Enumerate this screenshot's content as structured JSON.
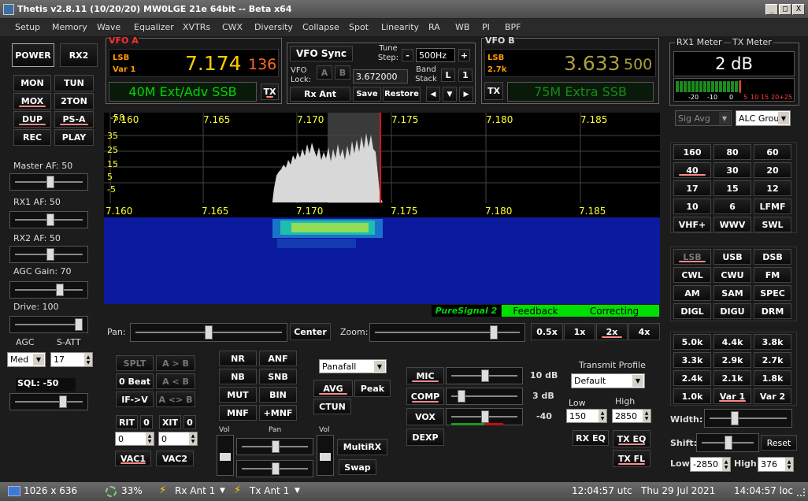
{
  "titlebar": {
    "title": "Thetis v2.8.11 (10/20/20) MW0LGE 21e 64bit -- Beta x64",
    "minimize": "_",
    "maximize": "□",
    "close": "X"
  },
  "menu": [
    "Setup",
    "Memory",
    "Wave",
    "Equalizer",
    "XVTRs",
    "CWX",
    "Diversity",
    "Collapse",
    "Spot",
    "Linearity",
    "RA",
    "WB",
    "PI",
    "BPF"
  ],
  "left": {
    "power": "POWER",
    "rx2": "RX2",
    "mon": "MON",
    "tun": "TUN",
    "mox": "MOX",
    "twoton": "2TON",
    "dup": "DUP",
    "psa": "PS-A",
    "rec": "REC",
    "play": "PLAY",
    "master_af_label": "Master AF: ",
    "master_af": "50",
    "rx1_af_label": "RX1 AF: ",
    "rx1_af": "50",
    "rx2_af_label": "RX2 AF: ",
    "rx2_af": "50",
    "agc_gain_label": "AGC Gain: ",
    "agc_gain": "70",
    "drive_label": "Drive: ",
    "drive": "100",
    "agc_label": "AGC",
    "satt_label": "S-ATT",
    "agc_value": "Med",
    "satt_value": "17",
    "sql_label": "SQL: ",
    "sql_value": "-50"
  },
  "vfo_a": {
    "label": "VFO A",
    "mode": "LSB",
    "var": "Var 1",
    "freq": "7.174",
    "sub": "136",
    "band": "40M Ext/Adv SSB",
    "tx": "TX"
  },
  "vfo_mid": {
    "sync": "VFO Sync",
    "tune_step_label": "Tune Step:",
    "minus": "-",
    "tune_step": "500Hz",
    "plus": "+",
    "lock_label": "VFO Lock:",
    "lock_a": "A",
    "lock_b": "B",
    "lock_freq": "3.672000",
    "band_stack_label": "Band Stack",
    "l": "L",
    "one": "1",
    "rx_ant": "Rx Ant",
    "save": "Save",
    "restore": "Restore",
    "left": "◀",
    "down": "▼",
    "right": "▶"
  },
  "vfo_b": {
    "label": "VFO B",
    "mode": "LSB",
    "var": "2.7k",
    "freq": "3.633",
    "sub": "500",
    "band": "75M Extra SSB",
    "tx": "TX"
  },
  "meter": {
    "rx1_title": "RX1 Meter",
    "tx_title": "TX Meter",
    "reading": "2 dB",
    "scale": [
      "-20",
      "-10",
      "0",
      "5",
      "10",
      "15",
      "20+25"
    ],
    "level_fraction": 0.55,
    "rx_select": "Sig Avg",
    "tx_select": "ALC Group"
  },
  "pan": {
    "freqs": [
      "7.160",
      "7.165",
      "7.170",
      "7.175",
      "7.180",
      "7.185"
    ],
    "db": [
      "-58",
      "35",
      "25",
      "15",
      "5",
      "-5"
    ]
  },
  "puresignal": {
    "name": "PureSignal 2",
    "feedback": "Feedback",
    "correcting": "Correcting"
  },
  "panzoom": {
    "pan_label": "Pan:",
    "center": "Center",
    "zoom_label": "Zoom:",
    "z05": "0.5x",
    "z1": "1x",
    "z2": "2x",
    "z4": "4x"
  },
  "bands": [
    "160",
    "80",
    "60",
    "40",
    "30",
    "20",
    "17",
    "15",
    "12",
    "10",
    "6",
    "LFMF",
    "VHF+",
    "WWV",
    "SWL"
  ],
  "modes": [
    "LSB",
    "USB",
    "DSB",
    "CWL",
    "CWU",
    "FM",
    "AM",
    "SAM",
    "SPEC",
    "DIGL",
    "DIGU",
    "DRM"
  ],
  "filters": [
    "5.0k",
    "4.4k",
    "3.8k",
    "3.3k",
    "2.9k",
    "2.7k",
    "2.4k",
    "2.1k",
    "1.8k",
    "1.0k",
    "Var 1",
    "Var 2"
  ],
  "filter_ctrl": {
    "width_label": "Width:",
    "shift_label": "Shift:",
    "reset": "Reset",
    "low_label": "Low",
    "low": "-2850",
    "high_label": "High",
    "high": "376"
  },
  "bottom_left": {
    "splt": "SPLT",
    "a_to_b": "A > B",
    "zero_beat": "0 Beat",
    "b_to_a": "A < B",
    "if_v": "IF->V",
    "swap_ab": "A <> B",
    "rit": "RIT",
    "rit_v": "0",
    "xit": "XIT",
    "xit_v": "0",
    "rit_val": "0",
    "xit_val": "0",
    "vac1": "VAC1",
    "vac2": "VAC2"
  },
  "dsp": {
    "nr": "NR",
    "anf": "ANF",
    "nb": "NB",
    "snb": "SNB",
    "mut": "MUT",
    "bin": "BIN",
    "mnf": "MNF",
    "pmnf": "+MNF",
    "display_mode": "Panafall",
    "avg": "AVG",
    "peak": "Peak",
    "ctun": "CTUN"
  },
  "multirx": {
    "vol1": "Vol",
    "pan": "Pan",
    "vol2": "Vol",
    "multirx": "MultiRX",
    "swap": "Swap"
  },
  "tx": {
    "mic": "MIC",
    "mic_val": "10 dB",
    "comp": "COMP",
    "comp_val": "3 dB",
    "vox": "VOX",
    "vox_val": "-40",
    "dexp": "DEXP",
    "profile_label": "Transmit Profile",
    "profile": "Default",
    "low_label": "Low",
    "low": "150",
    "high_label": "High",
    "high": "2850",
    "rx_eq": "RX EQ",
    "tx_eq": "TX EQ",
    "tx_fl": "TX FL"
  },
  "status": {
    "size": "1026 x 636",
    "cpu": "33%",
    "rx_ant": "Rx Ant 1",
    "tx_ant": "Tx Ant 1",
    "utc": "12:04:57 utc",
    "date": "Thu 29 Jul 2021",
    "loc": "14:04:57 loc"
  },
  "colors": {
    "vfo_a_freq": "#ffcc00",
    "vfo_b_freq": "#aaa03a",
    "accent_red": "#ff2a2a",
    "green": "#00d600",
    "waterfall": "#0b1a9e"
  }
}
